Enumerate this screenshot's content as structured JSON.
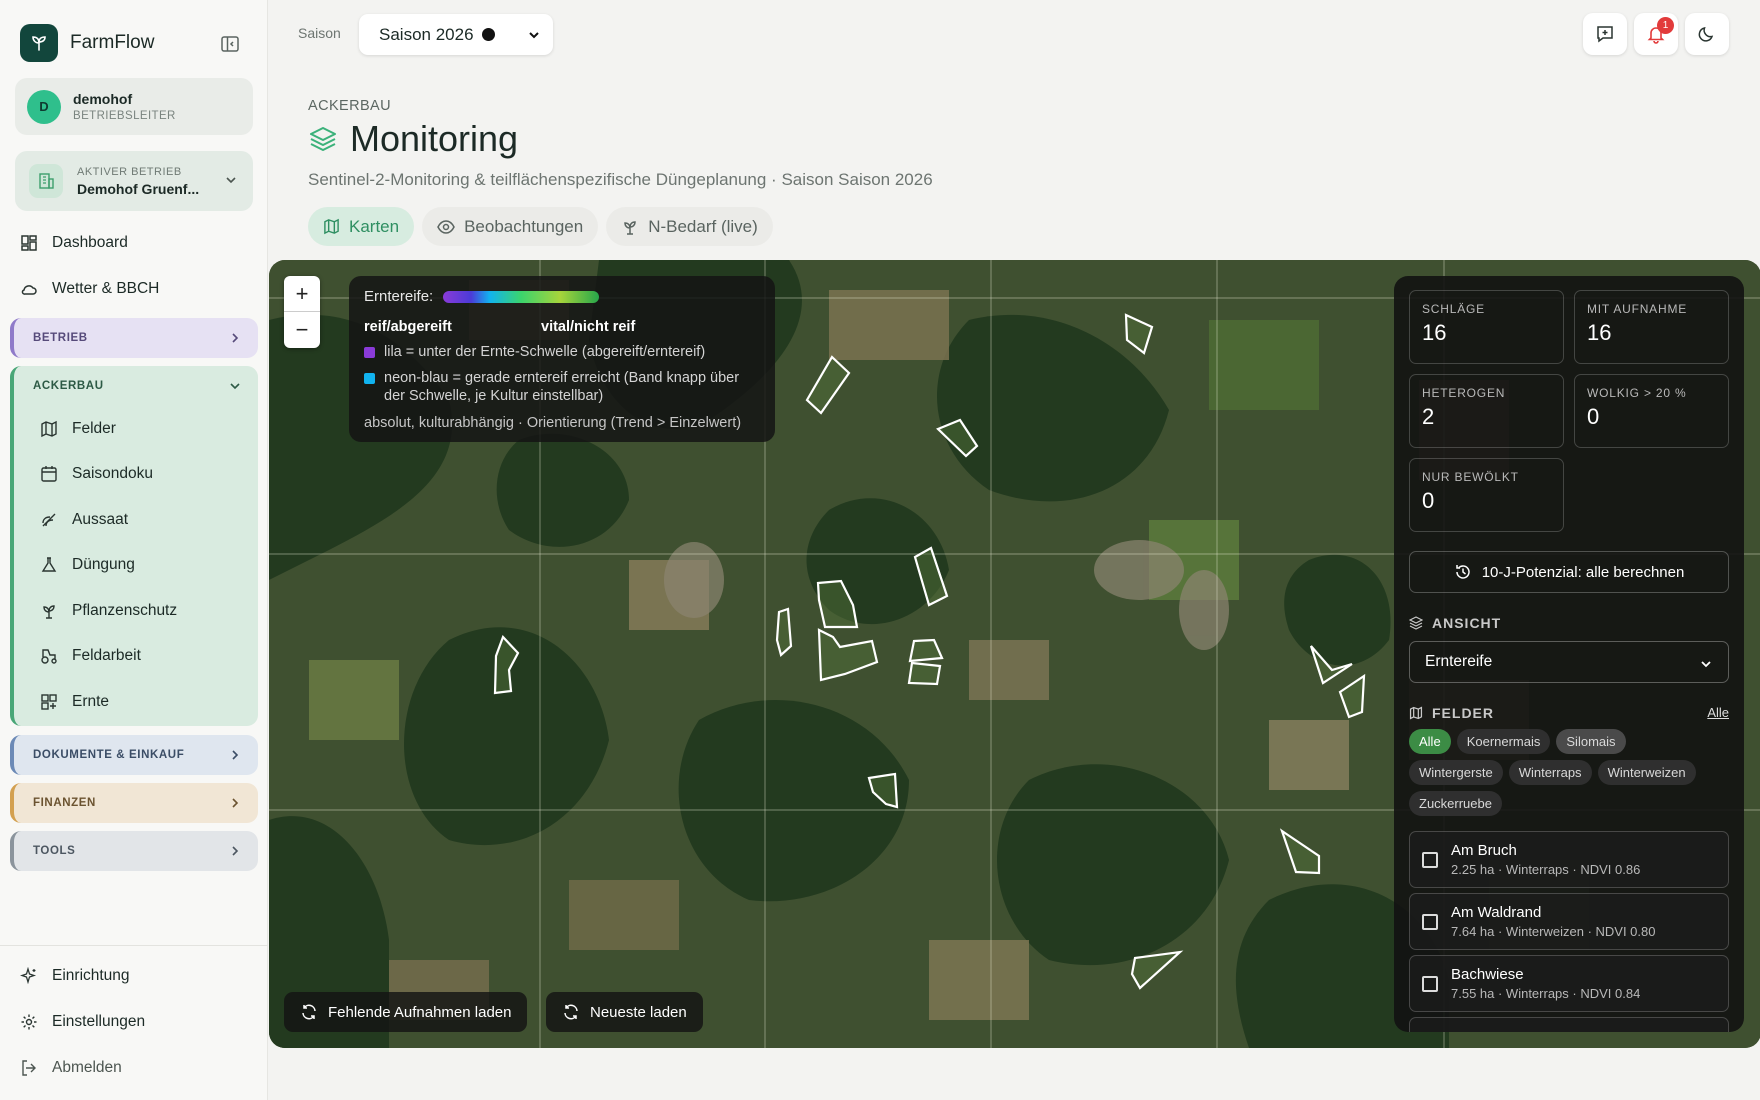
{
  "app": {
    "name": "FarmFlow"
  },
  "user": {
    "initial": "D",
    "name": "demohof",
    "role": "BETRIEBSLEITER"
  },
  "farm": {
    "label": "AKTIVER BETRIEB",
    "name": "Demohof Gruenf..."
  },
  "nav": {
    "dashboard": "Dashboard",
    "weather": "Wetter & BBCH",
    "groups": {
      "betrieb": "BETRIEB",
      "ackerbau": "ACKERBAU",
      "doku": "DOKUMENTE & EINKAUF",
      "finanzen": "FINANZEN",
      "tools": "TOOLS"
    },
    "ackerbau_items": [
      "Felder",
      "Saisondoku",
      "Aussaat",
      "Düngung",
      "Pflanzenschutz",
      "Feldarbeit",
      "Ernte"
    ],
    "bottom": {
      "setup": "Einrichtung",
      "settings": "Einstellungen",
      "logout": "Abmelden"
    }
  },
  "header": {
    "season_label": "Saison",
    "season_value": "Saison 2026",
    "notification_count": "1"
  },
  "page": {
    "breadcrumb": "ACKERBAU",
    "title": "Monitoring",
    "subtitle": "Sentinel-2-Monitoring & teilflächenspezifische Düngeplanung · Saison Saison 2026",
    "tabs": [
      "Karten",
      "Beobachtungen",
      "N-Bedarf (live)"
    ],
    "active_tab": "Karten"
  },
  "map": {
    "zoom_in": "+",
    "zoom_out": "−",
    "legend": {
      "title": "Erntereife:",
      "left_label": "reif/abgereift",
      "right_label": "vital/nicht reif",
      "purple_note": "lila = unter der Ernte-Schwelle (abgereift/erntereif)",
      "blue_note": "neon-blau = gerade erntereif erreicht (Band knapp über der Schwelle, je Kultur einstellbar)",
      "footer": "absolut, kulturabhängig · Orientierung (Trend > Einzelwert)",
      "colors": {
        "purple": "#8a3bd8",
        "blue": "#11b3ef"
      }
    },
    "load_missing": "Fehlende Aufnahmen laden",
    "load_latest": "Neueste laden"
  },
  "panel": {
    "stats": [
      {
        "label": "SCHLÄGE",
        "value": "16"
      },
      {
        "label": "MIT AUFNAHME",
        "value": "16"
      },
      {
        "label": "HETEROGEN",
        "value": "2"
      },
      {
        "label": "WOLKIG > 20 %",
        "value": "0"
      },
      {
        "label": "NUR BEWÖLKT",
        "value": "0"
      }
    ],
    "potential_button": "10-J-Potenzial: alle berechnen",
    "view_heading": "ANSICHT",
    "view_value": "Erntereife",
    "fields_heading": "FELDER",
    "fields_all_link": "Alle",
    "chips": [
      "Alle",
      "Koernermais",
      "Silomais",
      "Wintergerste",
      "Winterraps",
      "Winterweizen",
      "Zuckerruebe"
    ],
    "active_chip": "Alle",
    "fields": [
      {
        "name": "Am Bruch",
        "meta": "2.25 ha · Winterraps · NDVI 0.86"
      },
      {
        "name": "Am Waldrand",
        "meta": "7.64 ha · Winterweizen · NDVI 0.80"
      },
      {
        "name": "Bachwiese",
        "meta": "7.55 ha · Winterraps · NDVI 0.84"
      }
    ]
  }
}
